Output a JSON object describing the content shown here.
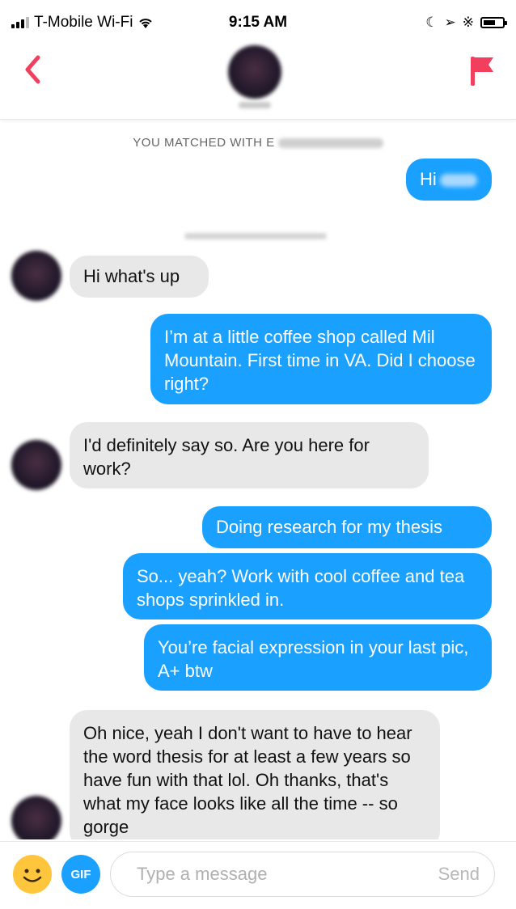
{
  "status_bar": {
    "carrier": "T-Mobile Wi-Fi",
    "time": "9:15 AM"
  },
  "header": {
    "back_icon": "chevron-left-icon",
    "flag_icon": "flag-icon",
    "accent_color": "#f33f5e"
  },
  "chat": {
    "match_text": "YOU MATCHED WITH E",
    "messages": [
      {
        "from": "me",
        "text": "Hi"
      },
      {
        "from": "them",
        "text": "Hi what's up"
      },
      {
        "from": "me",
        "text": "I’m at a little coffee shop called Mil Mountain. First time in VA. Did I choose right?"
      },
      {
        "from": "them",
        "text": "I'd definitely say so. Are you here for work?"
      },
      {
        "from": "me",
        "text": "Doing research for my thesis"
      },
      {
        "from": "me",
        "text": "So... yeah? Work with cool coffee and tea shops sprinkled in."
      },
      {
        "from": "me",
        "text": "You’re facial expression in your last pic, A+ btw"
      },
      {
        "from": "them",
        "text": "Oh nice, yeah I don't want to have to hear the word thesis for at least a few years so have fun with that lol. Oh thanks, that's what my face looks like all the time -- so gorge"
      }
    ]
  },
  "input_bar": {
    "gif_label": "GIF",
    "placeholder": "Type a message",
    "send_label": "Send"
  },
  "colors": {
    "sent_bubble": "#1aa1ff",
    "received_bubble": "#e8e8e8",
    "emoji": "#ffc53d"
  }
}
